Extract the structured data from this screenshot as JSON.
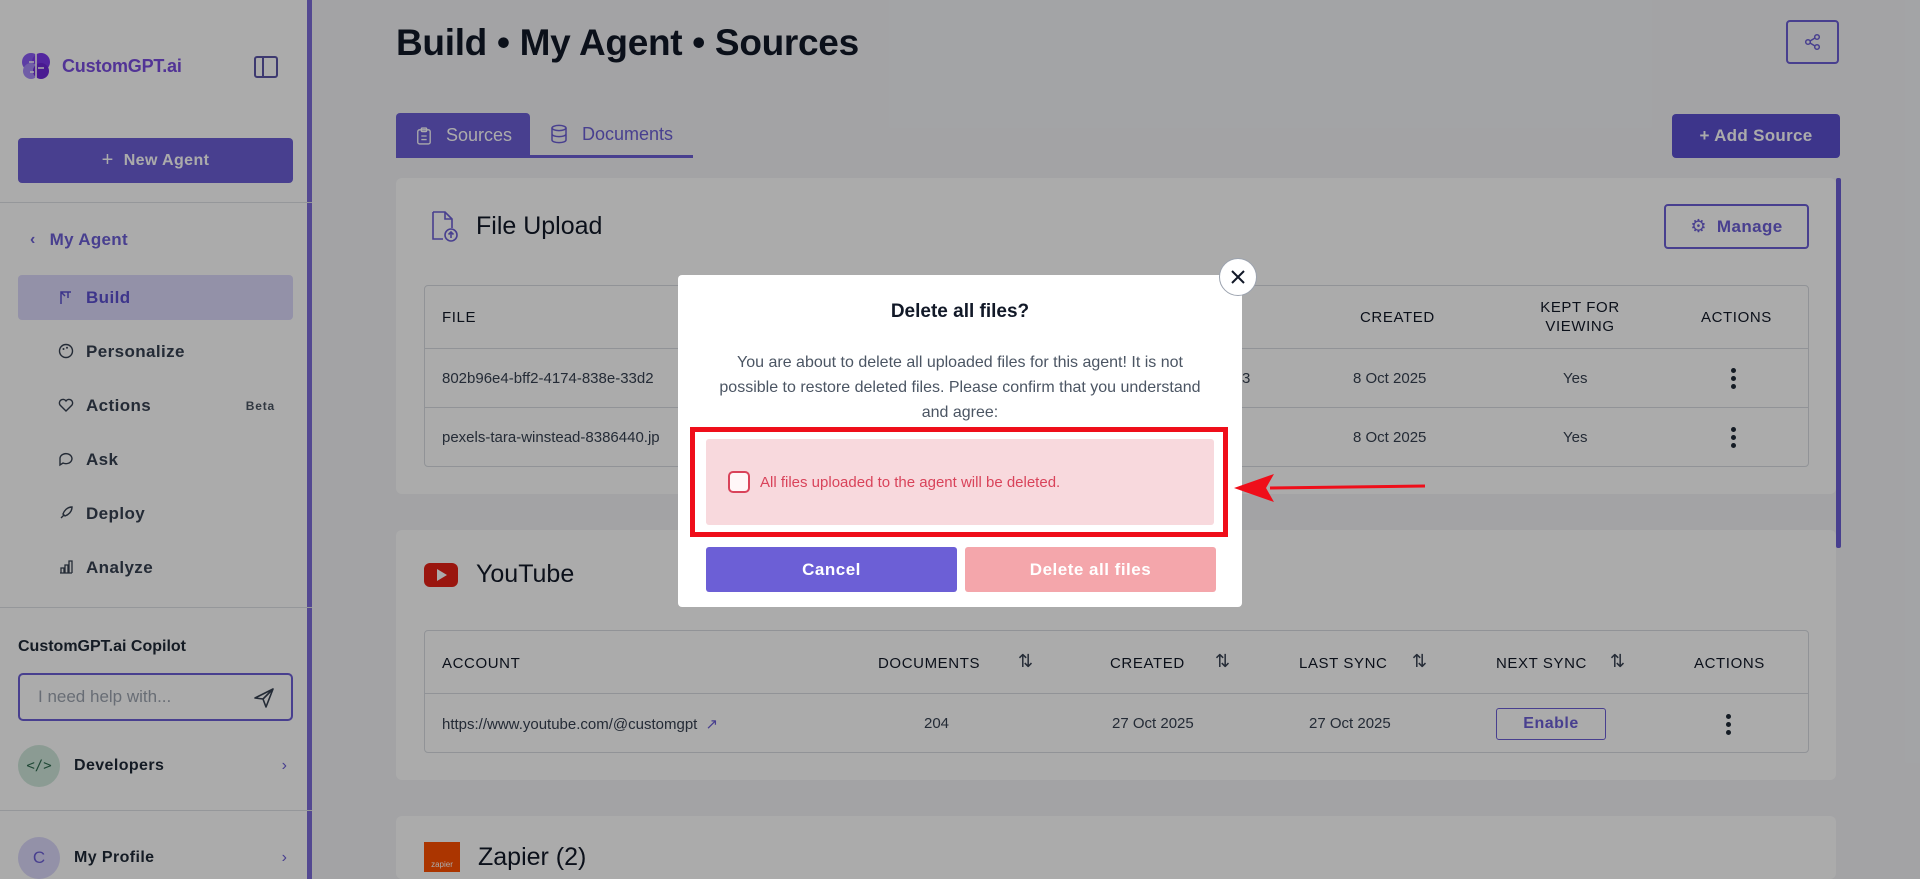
{
  "brand": {
    "name": "CustomGPT.ai"
  },
  "sidebar": {
    "new_agent_label": "New Agent",
    "back_label": "My Agent",
    "items": [
      {
        "label": "Build",
        "icon": "crane-icon",
        "active": true
      },
      {
        "label": "Personalize",
        "icon": "palette-icon",
        "active": false
      },
      {
        "label": "Actions",
        "icon": "heart-icon",
        "badge": "Beta",
        "active": false
      },
      {
        "label": "Ask",
        "icon": "chat-icon",
        "active": false
      },
      {
        "label": "Deploy",
        "icon": "rocket-icon",
        "active": false
      },
      {
        "label": "Analyze",
        "icon": "bar-chart-icon",
        "active": false
      }
    ],
    "copilot_title": "CustomGPT.ai Copilot",
    "copilot_placeholder": "I need help with...",
    "developers_label": "Developers",
    "developers_avatar": "</>",
    "profile_label": "My Profile",
    "profile_avatar": "C"
  },
  "header": {
    "title": "Build • My Agent • Sources",
    "tabs": [
      {
        "label": "Sources",
        "icon": "clipboard-icon",
        "active": true
      },
      {
        "label": "Documents",
        "icon": "database-icon",
        "active": false
      }
    ],
    "add_source_label": "+ Add Source"
  },
  "file_upload": {
    "title": "File Upload",
    "manage_label": "Manage",
    "columns": [
      "FILE",
      "CREATED",
      "KEPT FOR VIEWING",
      "ACTIONS"
    ],
    "rows": [
      {
        "file": "802b96e4-bff2-4174-838e-33d2",
        "created": "8 Oct 2025",
        "kept": "Yes",
        "partial": "3"
      },
      {
        "file": "pexels-tara-winstead-8386440.jp",
        "created": "8 Oct 2025",
        "kept": "Yes",
        "partial": ""
      }
    ]
  },
  "youtube": {
    "title": "YouTube",
    "columns": [
      "ACCOUNT",
      "DOCUMENTS",
      "CREATED",
      "LAST SYNC",
      "NEXT SYNC",
      "ACTIONS"
    ],
    "rows": [
      {
        "account": "https://www.youtube.com/@customgpt",
        "documents": "204",
        "created": "27 Oct 2025",
        "last_sync": "27 Oct 2025",
        "next_sync_label": "Enable"
      }
    ]
  },
  "zapier": {
    "title": "Zapier (2)",
    "logo_text": "zapier"
  },
  "modal": {
    "title": "Delete all files?",
    "text": "You are about to delete all uploaded files for this agent! It is not possible to restore deleted files. Please confirm that you understand and agree:",
    "checkbox_label": "All files uploaded to the agent will be deleted.",
    "cancel_label": "Cancel",
    "delete_label": "Delete all files"
  },
  "colors": {
    "accent": "#6c5fd6",
    "danger": "#ef0e1a",
    "youtube": "#e62117",
    "zapier": "#ff4f00"
  }
}
